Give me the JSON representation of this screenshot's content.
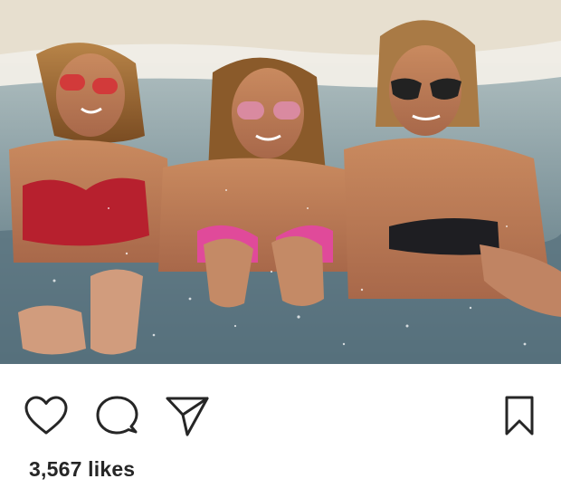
{
  "post": {
    "image": {
      "subject": "beach-photo"
    },
    "actions": {
      "like_icon": "heart-icon",
      "comment_icon": "comment-bubble-icon",
      "share_icon": "paper-plane-icon",
      "save_icon": "bookmark-icon"
    },
    "likes_text": "3,567 likes"
  },
  "colors": {
    "icon_stroke": "#262626",
    "text": "#262626",
    "background": "#ffffff"
  }
}
